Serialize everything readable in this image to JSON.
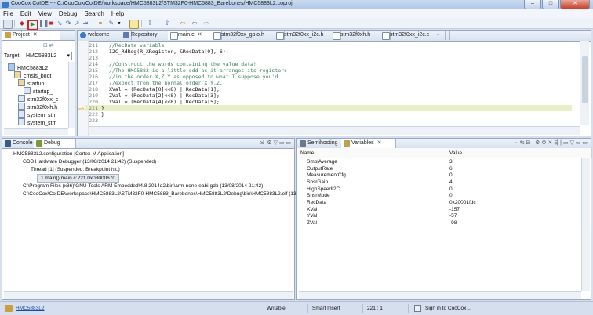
{
  "window": {
    "title": "CooCox CoIDE --- C:/CooCox/CoIDE/workspace/HMC5883L2/STM32F0-HMC5883_Barebones/HMC5883L2.coproj",
    "minimize": "–",
    "maximize": "□",
    "close": "✕"
  },
  "menu": [
    "File",
    "Edit",
    "View",
    "Debug",
    "Search",
    "Help"
  ],
  "project_panel": {
    "tab_label": "Project",
    "target_label": "Target",
    "target_value": "HMC5883L2",
    "tree": [
      "HMC5883L2",
      "cmsis_boot",
      "startup",
      "startup_",
      "stm32f0xx_c",
      "stm32f0xh.h",
      "system_stm",
      "system_stm"
    ]
  },
  "editor": {
    "tabs": [
      "welcome",
      "Repository",
      "main.c",
      "stm32f0xx_gpio.h",
      "stm32f0xx_i2c.h",
      "stm32f0xh.h",
      "stm32f0xx_i2c.c",
      ""
    ],
    "lines": [
      {
        "n": "211",
        "text": "//RecData variable",
        "comment": true
      },
      {
        "n": "212",
        "text": "I2C_RdReg(R_XRegister, &RecData[0], 6);",
        "comment": false
      },
      {
        "n": "213",
        "text": "",
        "comment": false
      },
      {
        "n": "214",
        "text": "//Construct the words containing the value data!",
        "comment": true
      },
      {
        "n": "215",
        "text": "//The HMC5883 is a little odd as it arranges its registers",
        "comment": true
      },
      {
        "n": "216",
        "text": "//in the order X,Z,Y as opposed to what I suppose you'd",
        "comment": true
      },
      {
        "n": "217",
        "text": "//expect from the normal order X,Y,Z.",
        "comment": true
      },
      {
        "n": "218",
        "text": "XVal = (RecData[0]<<8) | RecData[1];",
        "comment": false
      },
      {
        "n": "219",
        "text": "ZVal = (RecData[2]<<8) | RecData[3];",
        "comment": false
      },
      {
        "n": "220",
        "text": "YVal = (RecData[4]<<8) | RecData[5];",
        "comment": false
      },
      {
        "n": "221",
        "text": "}",
        "comment": false
      },
      {
        "n": "222",
        "text": "}",
        "comment": false
      },
      {
        "n": "223",
        "text": "",
        "comment": false
      }
    ]
  },
  "console_panel": {
    "tabs": [
      "Console",
      "Debug"
    ],
    "lines": [
      "HMC5883L2.configuration [Cortex-M Application]",
      "GDB Hardware Debugger (13/08/2014 21:42) (Suspended)",
      "Thread [1] (Suspended: Breakpoint hit.)",
      "1 main() main.c:221 0x08000670",
      "C:\\Program Files (x86)\\GNU Tools ARM Embedded\\4.8 2014q2\\bin\\arm-none-eabi-gdb (13/08/2014 21:42)",
      "C:\\CooCox\\CoIDE\\workspace\\HMC5883L2\\STM32F0-HMC5883_Barebones\\HMC5883L2\\Debug\\bin\\HMC5883L2.elf (13"
    ]
  },
  "variables_panel": {
    "tabs": [
      "Semihosting",
      "Variables"
    ],
    "col_name": "Name",
    "col_value": "Value",
    "rows": [
      {
        "name": "SmplAverage",
        "value": "3"
      },
      {
        "name": "OutputRate",
        "value": "6"
      },
      {
        "name": "MeasurementCfg",
        "value": "0"
      },
      {
        "name": "SnsrGain",
        "value": "4"
      },
      {
        "name": "HighSpeedI2C",
        "value": "0"
      },
      {
        "name": "SnsrMode",
        "value": "0"
      },
      {
        "name": "RecData",
        "value": "0x20001fdc"
      },
      {
        "name": "XVal",
        "value": "-157"
      },
      {
        "name": "YVal",
        "value": "-57"
      },
      {
        "name": "ZVal",
        "value": "-98"
      }
    ]
  },
  "status": {
    "project": "HMC5883L2",
    "writable": "Writable",
    "insert": "Smart Insert",
    "position": "221 : 1",
    "signin": "Sign in to CooCox..."
  },
  "colors": {
    "accent": "#3a79c8",
    "debug_highlight": "#e8f0c8",
    "breakpoint_arrow": "#f0c020"
  }
}
